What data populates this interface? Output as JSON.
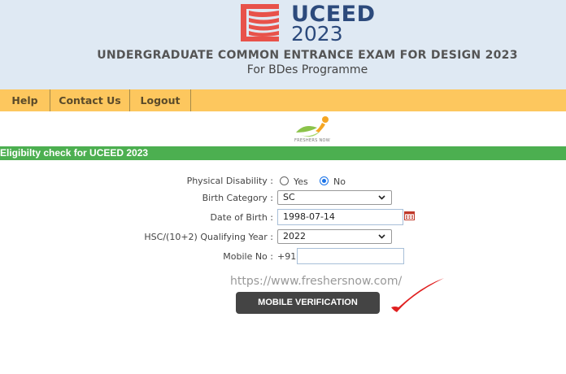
{
  "header": {
    "logo_word": "UCEED",
    "logo_year": "2023",
    "title": "UNDERGRADUATE COMMON ENTRANCE EXAM FOR DESIGN 2023",
    "subtitle": "For BDes Programme"
  },
  "nav": {
    "items": [
      {
        "label": "Help"
      },
      {
        "label": "Contact Us"
      },
      {
        "label": "Logout"
      }
    ]
  },
  "watermark": {
    "logo_text": "FRESHERS NOW",
    "url": "https://www.freshersnow.com/"
  },
  "section": {
    "title": "Eligibilty check for UCEED 2023"
  },
  "form": {
    "disability": {
      "label": "Physical Disability :",
      "options": [
        "Yes",
        "No"
      ],
      "selected": "No"
    },
    "birth_category": {
      "label": "Birth Category :",
      "value": "SC"
    },
    "dob": {
      "label": "Date of Birth :",
      "value": "1998-07-14"
    },
    "qualifying_year": {
      "label": "HSC/(10+2) Qualifying Year :",
      "value": "2022"
    },
    "mobile": {
      "label": "Mobile No :",
      "prefix": "+91",
      "value": ""
    },
    "submit_label": "MOBILE VERIFICATION"
  },
  "colors": {
    "header_bg": "#dfe9f3",
    "nav_bg": "#fdc75e",
    "section_bar": "#4caf50",
    "button_bg": "#444444",
    "logo_red": "#e8524a",
    "logo_blue": "#2c4a7c",
    "tick_red": "#e02020"
  },
  "icons": [
    "uceed-logo-icon",
    "freshersnow-logo-icon",
    "calendar-icon",
    "chevron-down-icon",
    "checkmark-icon"
  ]
}
